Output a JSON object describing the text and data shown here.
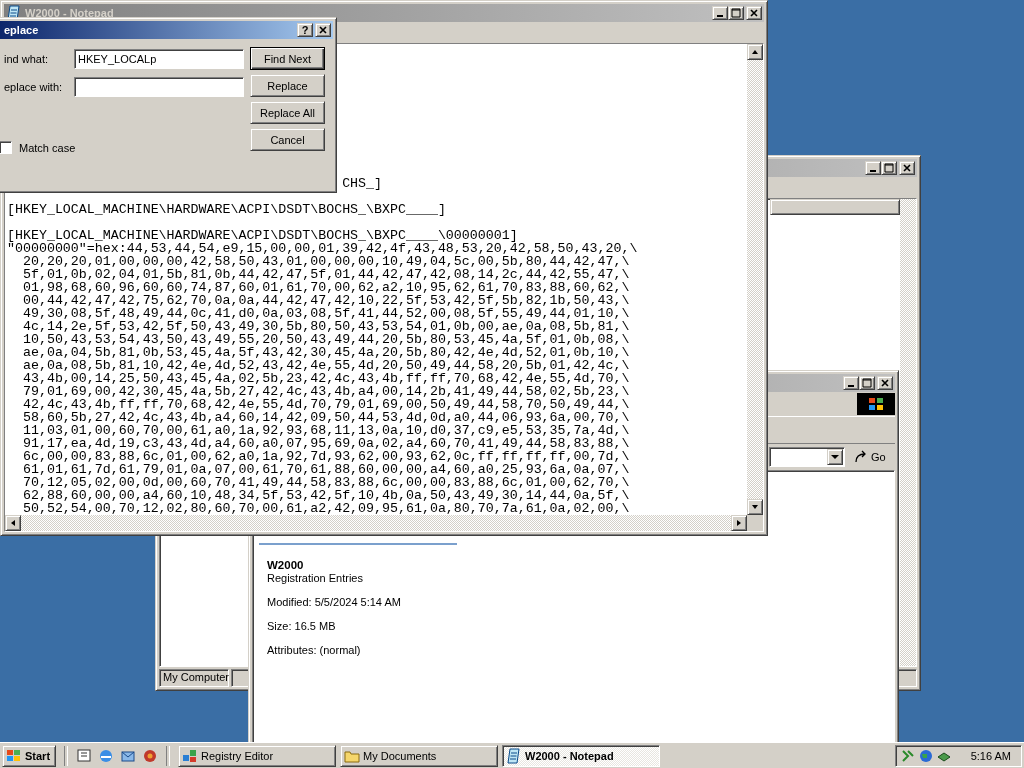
{
  "windows": [
    {
      "kind": "registry",
      "status_bar": "My Computer"
    },
    {
      "kind": "explorer",
      "go_button": "Go",
      "details": {
        "name": "W2000",
        "type": "Registration Entries",
        "lines": [
          "Modified: 5/5/2024 5:14 AM",
          "Size: 16.5 MB",
          "Attributes: (normal)"
        ]
      }
    },
    {
      "kind": "notepad",
      "title": "W2000 - Notepad",
      "lines": [
        {
          "kind": "partial",
          "text": "CHS_]"
        },
        {
          "kind": "key",
          "text": "[HKEY_LOCAL_MACHINE\\HARDWARE\\ACPI\\DSDT\\BOCHS_\\BXPC____]"
        },
        {
          "kind": "key",
          "text": "[HKEY_LOCAL_MACHINE\\HARDWARE\\ACPI\\DSDT\\BOCHS_\\BXPC____\\00000001]"
        },
        {
          "kind": "hex",
          "text": "\"00000000\"=hex:44,53,44,54,e9,15,00,00,01,39,42,4f,43,48,53,20,42,58,50,43,20,\\"
        },
        {
          "kind": "hex",
          "text": "  20,20,20,01,00,00,00,42,58,50,43,01,00,00,00,10,49,04,5c,00,5b,80,44,42,47,\\"
        },
        {
          "kind": "hex",
          "text": "  5f,01,0b,02,04,01,5b,81,0b,44,42,47,5f,01,44,42,47,42,08,14,2c,44,42,55,47,\\"
        },
        {
          "kind": "hex",
          "text": "  01,98,68,60,96,60,60,74,87,60,01,61,70,00,62,a2,10,95,62,61,70,83,88,60,62,\\"
        },
        {
          "kind": "hex",
          "text": "  00,44,42,47,42,75,62,70,0a,0a,44,42,47,42,10,22,5f,53,42,5f,5b,82,1b,50,43,\\"
        },
        {
          "kind": "hex",
          "text": "  49,30,08,5f,48,49,44,0c,41,d0,0a,03,08,5f,41,44,52,00,08,5f,55,49,44,01,10,\\"
        },
        {
          "kind": "hex",
          "text": "  4c,14,2e,5f,53,42,5f,50,43,49,30,5b,80,50,43,53,54,01,0b,00,ae,0a,08,5b,81,\\"
        },
        {
          "kind": "hex",
          "text": "  10,50,43,53,54,43,50,43,49,55,20,50,43,49,44,20,5b,80,53,45,4a,5f,01,0b,08,\\"
        },
        {
          "kind": "hex",
          "text": "  ae,0a,04,5b,81,0b,53,45,4a,5f,43,42,30,45,4a,20,5b,80,42,4e,4d,52,01,0b,10,\\"
        },
        {
          "kind": "hex",
          "text": "  ae,0a,08,5b,81,10,42,4e,4d,52,43,42,4e,55,4d,20,50,49,44,58,20,5b,01,42,4c,\\"
        },
        {
          "kind": "hex",
          "text": "  43,4b,00,14,25,50,43,45,4a,02,5b,23,42,4c,43,4b,ff,ff,70,68,42,4e,55,4d,70,\\"
        },
        {
          "kind": "hex",
          "text": "  79,01,69,00,42,30,45,4a,5b,27,42,4c,43,4b,a4,00,14,2b,41,49,44,58,02,5b,23,\\"
        },
        {
          "kind": "hex",
          "text": "  42,4c,43,4b,ff,ff,70,68,42,4e,55,4d,70,79,01,69,00,50,49,44,58,70,50,49,44,\\"
        },
        {
          "kind": "hex",
          "text": "  58,60,5b,27,42,4c,43,4b,a4,60,14,42,09,50,44,53,4d,0d,a0,44,06,93,6a,00,70,\\"
        },
        {
          "kind": "hex",
          "text": "  11,03,01,00,60,70,00,61,a0,1a,92,93,68,11,13,0a,10,d0,37,c9,e5,53,35,7a,4d,\\"
        },
        {
          "kind": "hex",
          "text": "  91,17,ea,4d,19,c3,43,4d,a4,60,a0,07,95,69,0a,02,a4,60,70,41,49,44,58,83,88,\\"
        },
        {
          "kind": "hex",
          "text": "  6c,00,00,83,88,6c,01,00,62,a0,1a,92,7d,93,62,00,93,62,0c,ff,ff,ff,ff,00,7d,\\"
        },
        {
          "kind": "hex",
          "text": "  61,01,61,7d,61,79,01,0a,07,00,61,70,61,88,60,00,00,a4,60,a0,25,93,6a,0a,07,\\"
        },
        {
          "kind": "hex",
          "text": "  70,12,05,02,00,0d,00,60,70,41,49,44,58,83,88,6c,00,00,83,88,6c,01,00,62,70,\\"
        },
        {
          "kind": "hex",
          "text": "  62,88,60,00,00,a4,60,10,48,34,5f,53,42,5f,10,4b,0a,50,43,49,30,14,44,0a,5f,\\"
        },
        {
          "kind": "hex",
          "text": "  50,52,54,00,70,12,02,80,60,70,00,61,a2,42,09,95,61,0a,80,70,7a,61,0a,02,00,\\"
        }
      ]
    }
  ],
  "dialog": {
    "title": "eplace",
    "help_button": "?",
    "fields": [
      {
        "label": "ind what:",
        "value": "HKEY_LOCALp"
      },
      {
        "label": "eplace with:"
      }
    ],
    "buttons": [
      {
        "label": "Find Next",
        "default": true
      },
      {
        "label": "Replace",
        "default": false
      },
      {
        "label": "Replace All",
        "default": false
      },
      {
        "label": "Cancel",
        "default": false
      }
    ],
    "checkbox": {
      "label": "Match case",
      "checked": false
    }
  },
  "taskbar": {
    "start": "Start",
    "tasks": [
      {
        "label": "Registry Editor",
        "selected": false,
        "kind": "registry"
      },
      {
        "label": "My Documents",
        "selected": false,
        "kind": "folder"
      },
      {
        "label": "W2000 - Notepad",
        "selected": true,
        "kind": "notepad"
      }
    ],
    "clock": "5:16 AM"
  }
}
